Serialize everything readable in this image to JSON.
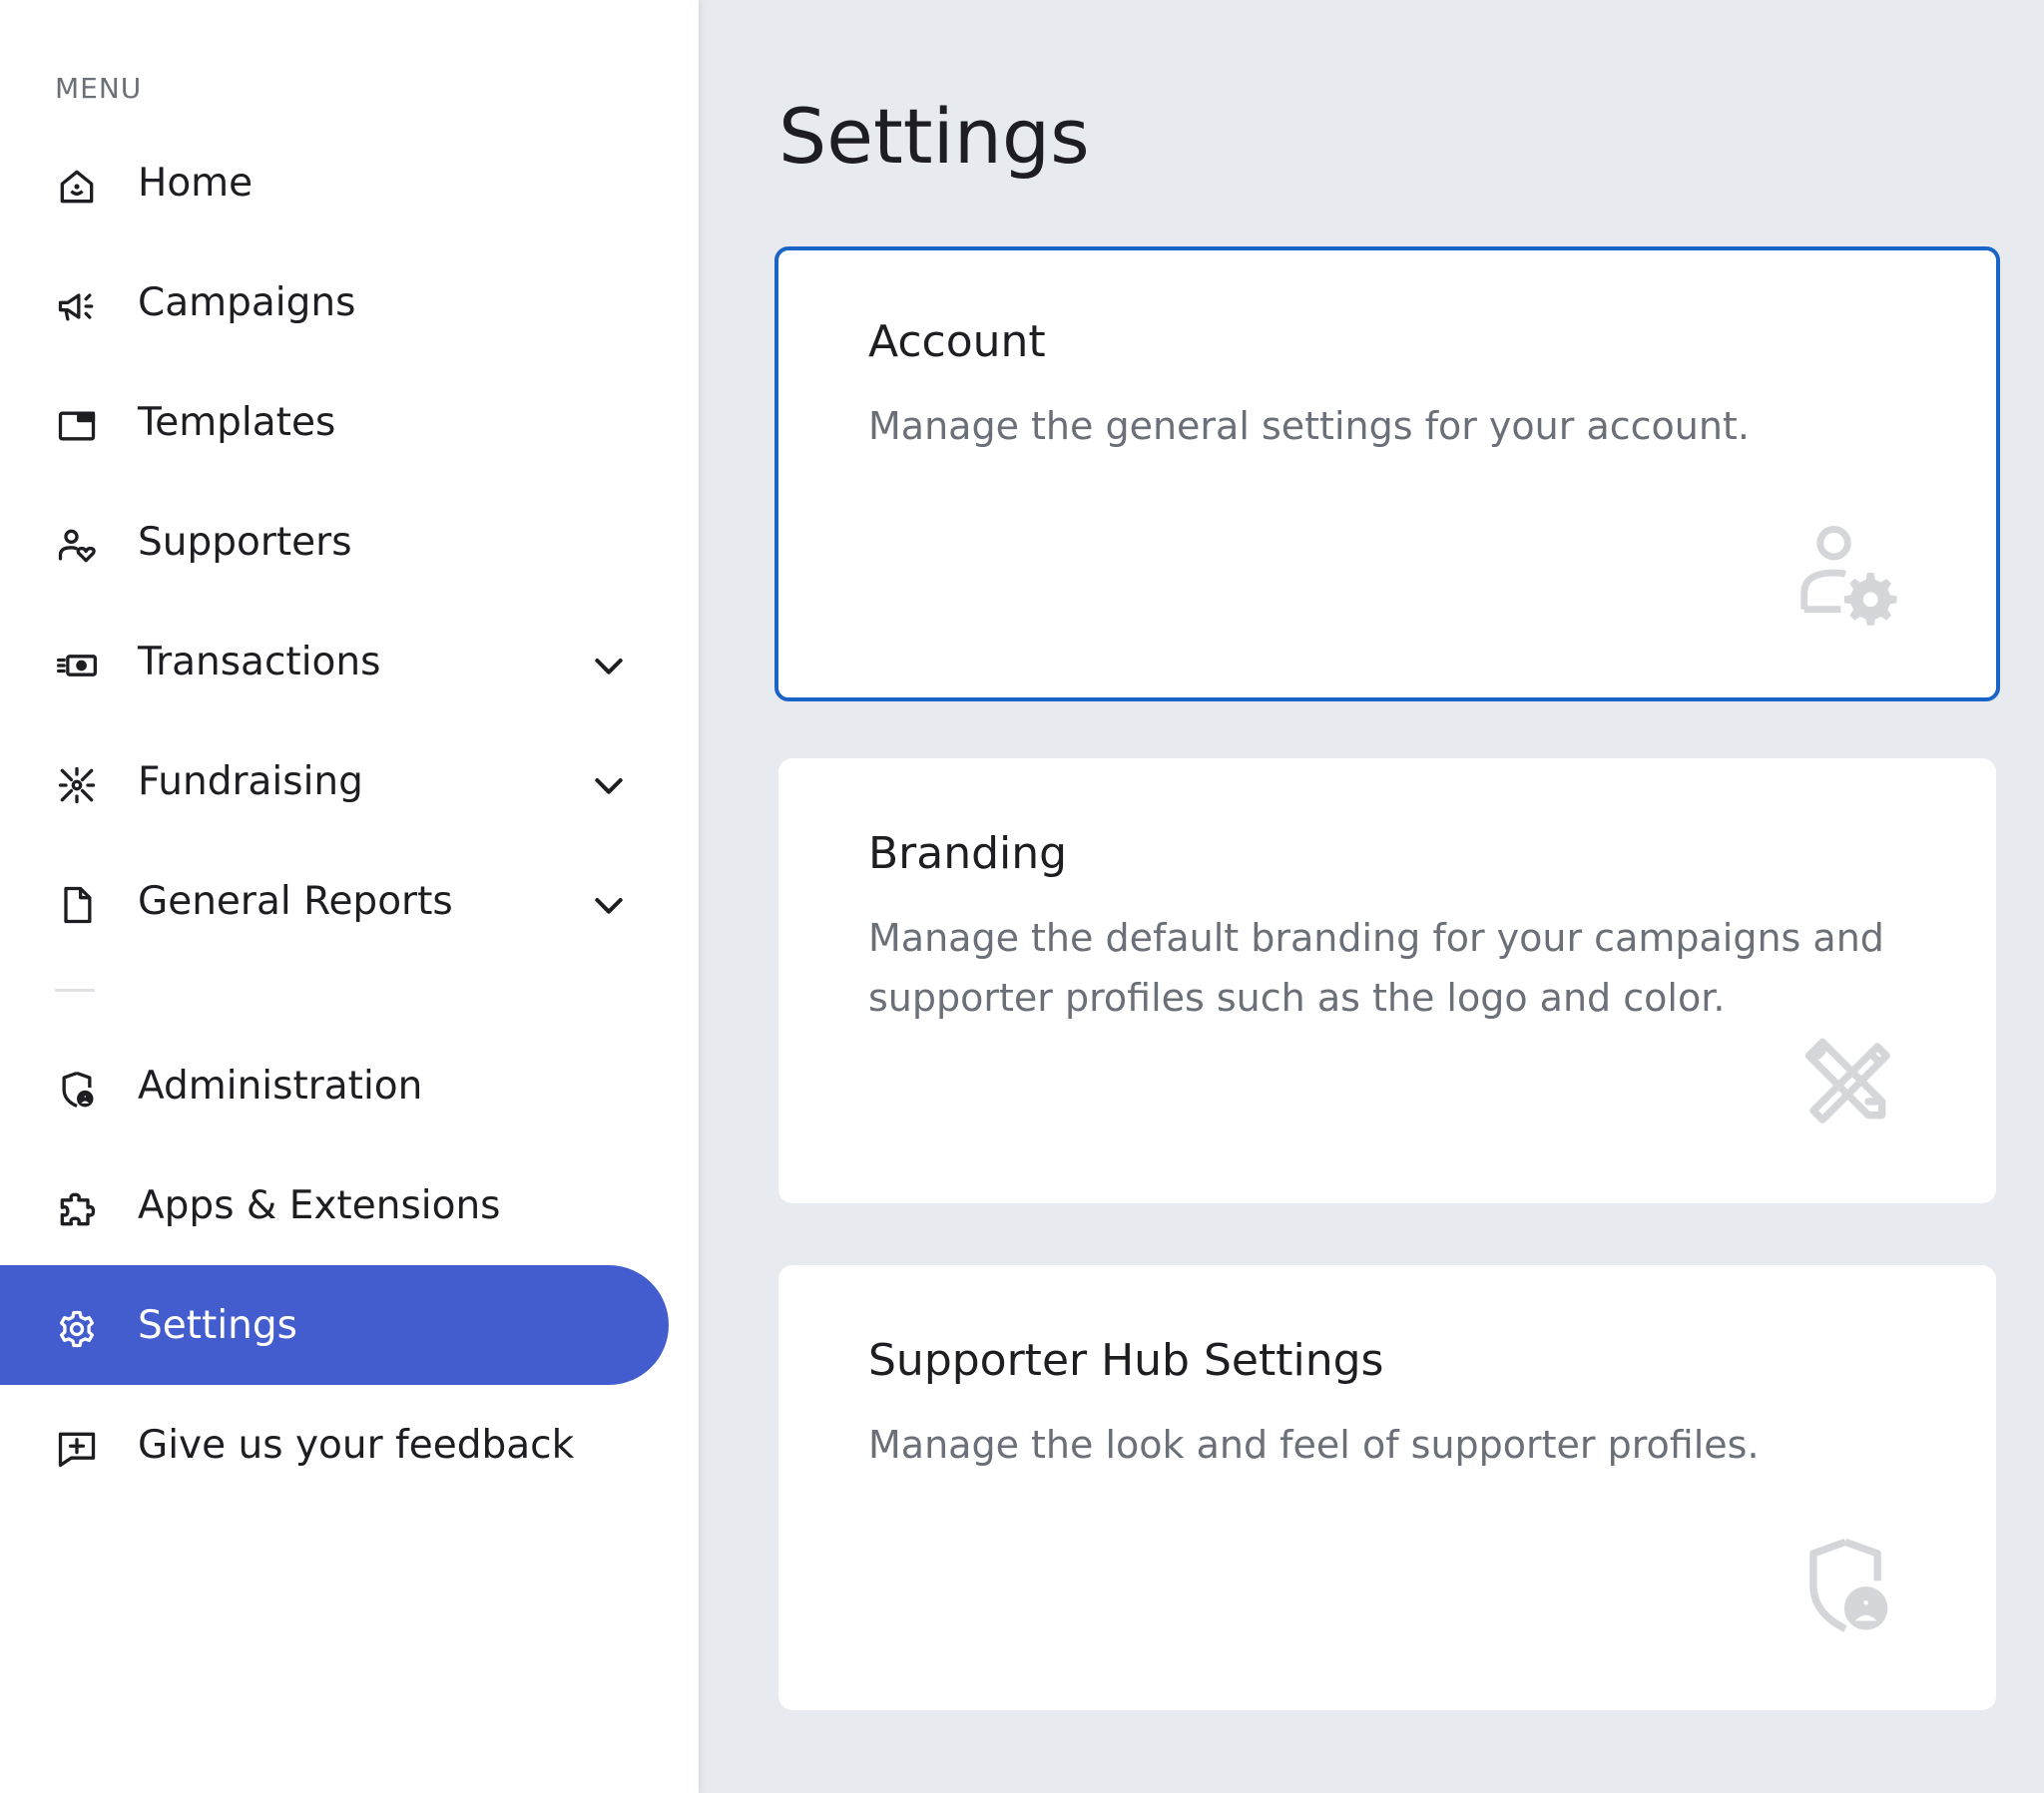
{
  "sidebar": {
    "menu_label": "MENU",
    "items": [
      {
        "label": "Home",
        "icon": "home-icon"
      },
      {
        "label": "Campaigns",
        "icon": "megaphone-icon"
      },
      {
        "label": "Templates",
        "icon": "template-icon"
      },
      {
        "label": "Supporters",
        "icon": "supporters-icon"
      },
      {
        "label": "Transactions",
        "icon": "cash-icon",
        "expandable": true
      },
      {
        "label": "Fundraising",
        "icon": "fundraising-icon",
        "expandable": true
      },
      {
        "label": "General Reports",
        "icon": "document-icon",
        "expandable": true
      },
      {
        "label": "Administration",
        "icon": "shield-user-icon"
      },
      {
        "label": "Apps & Extensions",
        "icon": "puzzle-icon"
      },
      {
        "label": "Settings",
        "icon": "gear-icon",
        "active": true
      },
      {
        "label": "Give us your feedback",
        "icon": "feedback-icon"
      }
    ]
  },
  "main": {
    "title": "Settings",
    "cards": [
      {
        "title": "Account",
        "description": "Manage the general settings for your account.",
        "icon": "user-gear-icon",
        "selected": true
      },
      {
        "title": "Branding",
        "description": "Manage the default branding for your campaigns and supporter profiles such as the logo and color.",
        "icon": "ruler-pencil-icon"
      },
      {
        "title": "Supporter Hub Settings",
        "description": "Manage the look and feel of supporter profiles.",
        "icon": "shield-user-icon"
      }
    ]
  },
  "colors": {
    "accent": "#435cce",
    "selected_border": "#1a63c7",
    "page_background": "#e7eaee",
    "muted_text": "#6b6f78"
  }
}
